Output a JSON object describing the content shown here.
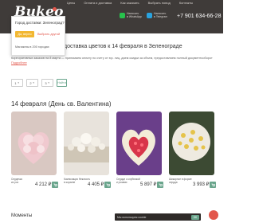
{
  "header": {
    "logo": "Bukeo",
    "nav": [
      "Цены",
      "Оплата и доставка",
      "Как заказать",
      "Выбрать повод",
      "Контакты"
    ],
    "contacts": [
      {
        "icon": "whatsapp-icon",
        "text": "Написать\nв WhatsApp",
        "color": "#27c24c"
      },
      {
        "icon": "telegram-icon",
        "text": "Написать\nв Telegram",
        "color": "#2aa3df"
      }
    ],
    "phone": "+7 901 634-66-28"
  },
  "popup": {
    "title": "Город доставки: Зеленоград?",
    "yes": "Да, верно",
    "other": "Выбрать другой",
    "note": "Магазины в 200 городах"
  },
  "page": {
    "title": "доставка цветов к 14 февраля в Зеленограде",
    "info": "Корпоративных заказов на 8 марта — принимаем оплату по счету от юр. лиц, даем скидки за объем, предоставляем полный документооборот",
    "info_link": "Подробнее"
  },
  "filters": {
    "items": [
      "1",
      "2",
      "3"
    ],
    "active": "Найти"
  },
  "section": {
    "title": "14 февраля (День св. Валентина)"
  },
  "products": [
    {
      "name": "Сердечко\nиз роз",
      "price": "4 212 ₽"
    },
    {
      "name": "Композиция Нежность\nв корзине",
      "price": "4 405 ₽"
    },
    {
      "name": "Сердце с клубникой\nи розами",
      "price": "5 897 ₽"
    },
    {
      "name": "Шикарное в форме\nсердца",
      "price": "3 993 ₽"
    }
  ],
  "footer": {
    "title": "Моменты",
    "cookie": "Мы используем cookie",
    "cookie_ok": "OK"
  }
}
